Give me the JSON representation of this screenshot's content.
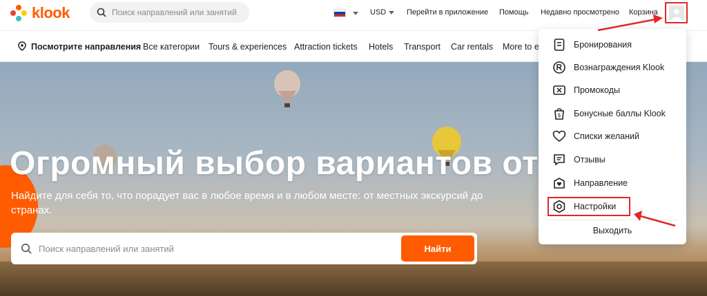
{
  "brand": {
    "name": "klook"
  },
  "search_top": {
    "placeholder": "Поиск направлений или занятий"
  },
  "top_nav": {
    "currency": "USD",
    "app": "Перейти в приложение",
    "help": "Помощь",
    "recent": "Недавно просмотрено",
    "cart": "Корзина"
  },
  "categories": [
    "Посмотрите направления",
    "Все категории",
    "Tours & experiences",
    "Attraction tickets",
    "Hotels",
    "Transport",
    "Car rentals",
    "More to e"
  ],
  "hero": {
    "title": "Огромный выбор вариантов от",
    "subtitle_line1": "Найдите для себя то, что порадует вас в любое время и в любом месте: от местных экскурсий до",
    "subtitle_line2": "странах.",
    "search_placeholder": "Поиск направлений или занятий",
    "search_button": "Найти"
  },
  "menu": {
    "items": [
      {
        "label": "Бронирования",
        "icon": "bookings-icon"
      },
      {
        "label": "Вознаграждения Klook",
        "icon": "rewards-icon"
      },
      {
        "label": "Промокоды",
        "icon": "promo-icon"
      },
      {
        "label": "Бонусные баллы Klook",
        "icon": "credits-icon"
      },
      {
        "label": "Списки желаний",
        "icon": "heart-icon"
      },
      {
        "label": "Отзывы",
        "icon": "reviews-icon"
      },
      {
        "label": "Направление",
        "icon": "destination-icon"
      },
      {
        "label": "Настройки",
        "icon": "settings-icon"
      }
    ],
    "logout": "Выходить"
  },
  "colors": {
    "accent": "#ff5b00",
    "annotation": "#e0272a"
  }
}
